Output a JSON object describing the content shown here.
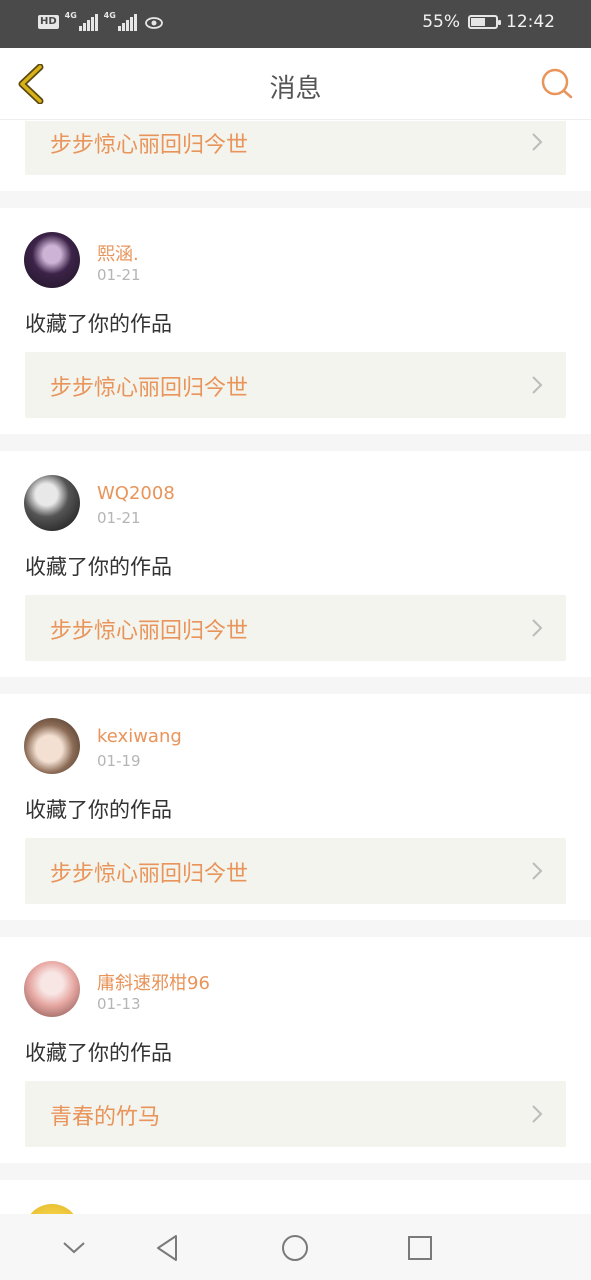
{
  "status_bar": {
    "hd_label": "HD",
    "net1": "4G",
    "net2": "4G",
    "battery_text": "55%",
    "battery_level": 0.55,
    "time": "12:42"
  },
  "header": {
    "title": "消息",
    "back_icon": "chevron-left-icon",
    "search_icon": "search-icon"
  },
  "colors": {
    "accent": "#e8945a",
    "back_icon": "#c9a400",
    "work_box_bg": "#f4f4ee"
  },
  "top_partial": {
    "work_title": "步步惊心丽回归今世"
  },
  "notifications": [
    {
      "username": "熙涵.",
      "date": "01-21",
      "action": "收藏了你的作品",
      "work_title": "步步惊心丽回归今世"
    },
    {
      "username": "WQ2008",
      "date": "01-21",
      "action": "收藏了你的作品",
      "work_title": "步步惊心丽回归今世"
    },
    {
      "username": "kexiwang",
      "date": "01-19",
      "action": "收藏了你的作品",
      "work_title": "步步惊心丽回归今世"
    },
    {
      "username": "庸斜速邪柑96",
      "date": "01-13",
      "action": "收藏了你的作品",
      "work_title": "青春的竹马"
    }
  ],
  "nav": {
    "down_icon": "chevron-down-icon",
    "back_icon": "triangle-back-icon",
    "home_icon": "circle-home-icon",
    "recent_icon": "square-recents-icon"
  }
}
